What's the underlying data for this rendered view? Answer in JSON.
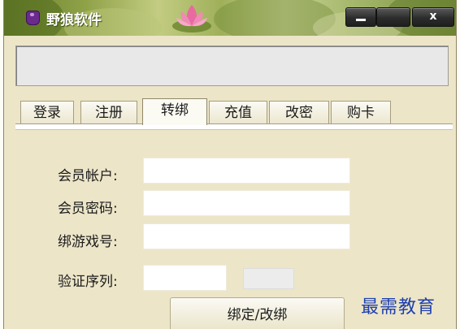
{
  "window": {
    "title": "野狼软件",
    "buttons": {
      "minimize": "",
      "maximize": "",
      "close": "x"
    }
  },
  "tabs": [
    {
      "label": "登录",
      "active": false
    },
    {
      "label": "注册",
      "active": false
    },
    {
      "label": "转绑",
      "active": true
    },
    {
      "label": "充值",
      "active": false
    },
    {
      "label": "改密",
      "active": false
    },
    {
      "label": "购卡",
      "active": false
    }
  ],
  "form": {
    "account_label": "会员帐户:",
    "account_value": "",
    "password_label": "会员密码:",
    "password_value": "",
    "game_id_label": "绑游戏号:",
    "game_id_value": "",
    "captcha_label": "验证序列:",
    "captcha_value": ""
  },
  "bind_button_label": "绑定/改绑",
  "watermark": "最需教育",
  "colors": {
    "accent": "#1d3fb0",
    "panel": "#ece5c8"
  },
  "icons": {
    "app": "app-icon",
    "decoration": "lotus-icon"
  }
}
